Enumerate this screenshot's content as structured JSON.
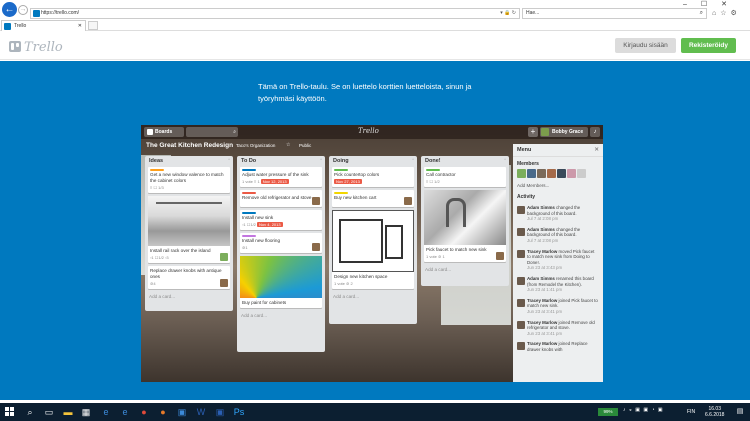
{
  "browser": {
    "url": "https://trello.com/",
    "tab_title": "Trello",
    "search_placeholder": "Hae...",
    "back_icon": "back-arrow-icon"
  },
  "header": {
    "logo_text": "Trello",
    "login_label": "Kirjaudu sisään",
    "register_label": "Rekisteröidy"
  },
  "intro": {
    "text": "Tämä on Trello-taulu. Se on luettelo korttien luetteloista, sinun ja työryhmäsi käyttöön."
  },
  "board": {
    "boards_label": "Boards",
    "logo": "Trello",
    "user_name": "Bobby Grace",
    "name": "The Great Kitchen Redesign",
    "org": "Taco's Organization",
    "visibility": "Public",
    "lists": [
      {
        "title": "Ideas",
        "cards": [
          {
            "text": "Get a new window valence to match the cabinet colors",
            "badges": "≡  ☐ 1/3"
          },
          {
            "text": "Install rail rack over the island",
            "badges": "▫1 ☐1/2 ▫3"
          },
          {
            "text": "Replace drawer knobs with antique ones",
            "badges": "⊘4"
          }
        ],
        "add": "Add a card..."
      },
      {
        "title": "To Do",
        "cards": [
          {
            "text": "Adjust water pressure of the sink",
            "badges": "1 vote  ≡ 1 ",
            "due": "Nov 12, 2013"
          },
          {
            "text": "Remove old refrigerator and stove",
            "badges": ""
          },
          {
            "text": "Install new sink",
            "badges": "▫1 ☐1/2",
            "due": "Nov 4, 2013"
          },
          {
            "text": "Install new flooring",
            "badges": "⊘1"
          },
          {
            "text": "Buy paint for cabinets",
            "badges": ""
          }
        ],
        "add": "Add a card..."
      },
      {
        "title": "Doing",
        "cards": [
          {
            "text": "Pick countertop colors",
            "badges": "",
            "due": "Nov 27, 2013"
          },
          {
            "text": "Buy new kitchen cart",
            "badges": ""
          },
          {
            "text": "Design new kitchen space",
            "badges": "1 vote ⊘ 2"
          }
        ],
        "add": "Add a card..."
      },
      {
        "title": "Done!",
        "cards": [
          {
            "text": "Call contractor",
            "badges": "≡  ☐ 1/2"
          },
          {
            "text": "Pick faucet to match new sink",
            "badges": "1 vote ⊘ 1"
          }
        ],
        "add": "Add a card..."
      }
    ],
    "menu": {
      "title": "Menu",
      "members_label": "Members",
      "add_members": "Add Members...",
      "activity_label": "Activity",
      "activities": [
        {
          "who": "Adam Simms",
          "text": " changed the background of this board.",
          "date": "Jul 7 at 2:08 pm"
        },
        {
          "who": "Adam Simms",
          "text": " changed the background of this board.",
          "date": "Jul 7 at 2:08 pm"
        },
        {
          "who": "Tracey Marlow",
          "text": " moved Pick faucet to match new sink from Doing to Done!.",
          "date": "Jun 23 at 3:43 pm"
        },
        {
          "who": "Adam Simms",
          "text": " renamed this board (from Remodel the Kitchen).",
          "date": "Jun 23 at 1:41 pm"
        },
        {
          "who": "Tracey Marlow",
          "text": " joined Pick faucet to match new sink.",
          "date": "Jun 23 at 3:41 pm"
        },
        {
          "who": "Tracey Marlow",
          "text": " joined Remove old refrigerator and stove.",
          "date": "Jun 23 at 3:41 pm"
        },
        {
          "who": "Tracey Marlow",
          "text": " joined Replace drawer knobs with",
          "date": ""
        }
      ]
    }
  },
  "taskbar": {
    "battery": "99%",
    "lang": "FIN",
    "time": "16.03",
    "date": "6.6.2018"
  }
}
